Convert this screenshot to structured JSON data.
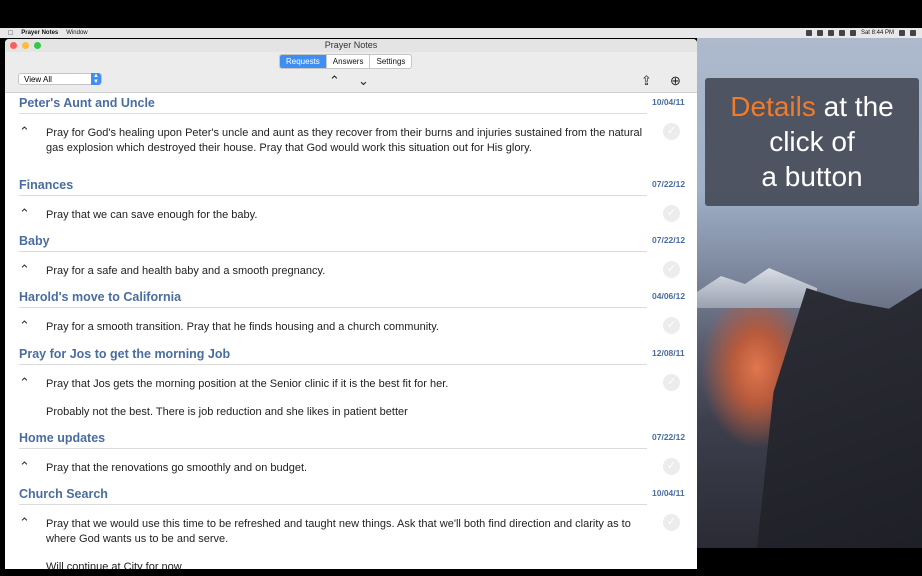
{
  "menubar": {
    "app": "Prayer Notes",
    "menu": "Window",
    "clock": "Sat 8:44 PM"
  },
  "window": {
    "title": "Prayer Notes"
  },
  "toolbar": {
    "tabs": [
      {
        "label": "Requests"
      },
      {
        "label": "Answers"
      },
      {
        "label": "Settings"
      }
    ],
    "active_tab": "Requests",
    "view_select": "View All"
  },
  "promo": {
    "accent": "Details",
    "line1_rest": " at the",
    "line2": "click of",
    "line3": "a button"
  },
  "items": [
    {
      "title": "Peter's Aunt and Uncle",
      "date": "10/04/11",
      "text": "Pray for God's healing upon Peter's uncle and aunt as they recover from their burns and injuries sustained from the natural gas explosion which destroyed their house.  Pray that God would work this situation out for His glory.",
      "note": ""
    },
    {
      "title": "Finances",
      "date": "07/22/12",
      "text": "Pray that we can save enough for the baby.",
      "note": ""
    },
    {
      "title": "Baby",
      "date": "07/22/12",
      "text": "Pray for a safe and health baby and a smooth pregnancy.",
      "note": ""
    },
    {
      "title": "Harold's move to California",
      "date": "04/06/12",
      "text": "Pray for a smooth transition. Pray that he finds housing and a church community.",
      "note": ""
    },
    {
      "title": "Pray for Jos to get the morning Job",
      "date": "12/08/11",
      "text": "Pray that Jos gets the morning position at the Senior clinic if it is the best fit for her.",
      "note": "Probably not the best. There is job reduction and she likes in patient better"
    },
    {
      "title": "Home updates",
      "date": "07/22/12",
      "text": "Pray that the renovations go smoothly and on budget.",
      "note": ""
    },
    {
      "title": "Church Search",
      "date": "10/04/11",
      "text": "Pray that we would use this time to be refreshed and taught new things. Ask that we'll both find direction and clarity as to where God wants us to be and serve.",
      "note": "Will continue at City for now"
    }
  ]
}
